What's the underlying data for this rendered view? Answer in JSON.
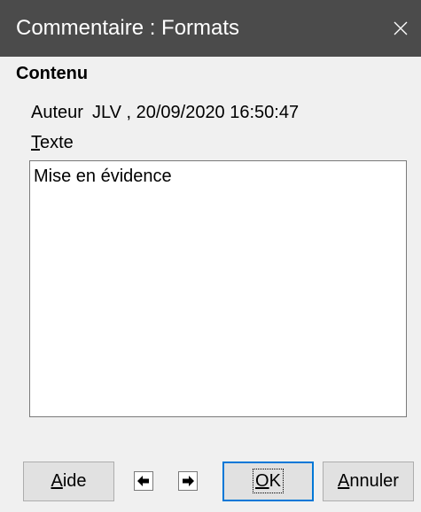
{
  "window": {
    "title": "Commentaire : Formats",
    "close_icon": "close-icon"
  },
  "content": {
    "heading": "Contenu",
    "author_label": "Auteur",
    "author_value": "JLV , 20/09/2020 16:50:47",
    "text_label_first": "T",
    "text_label_rest": "exte",
    "text_value": "Mise en évidence"
  },
  "buttons": {
    "help_first": "A",
    "help_rest": "ide",
    "prev_icon": "arrow-left-icon",
    "next_icon": "arrow-right-icon",
    "ok_first": "O",
    "ok_rest": "K",
    "cancel_first": "A",
    "cancel_rest": "nnuler"
  },
  "colors": {
    "titlebar": "#4b4b4b",
    "dialog_bg": "#f0f0f0",
    "focus_border": "#0078d7"
  }
}
